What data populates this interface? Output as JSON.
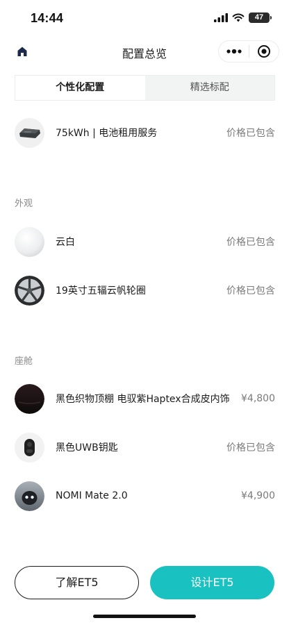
{
  "status_bar": {
    "time": "14:44",
    "battery": "47"
  },
  "nav": {
    "title": "配置总览"
  },
  "tabs": [
    {
      "label": "个性化配置",
      "active": true
    },
    {
      "label": "精选标配",
      "active": false
    }
  ],
  "battery_item": {
    "name": "75kWh | 电池租用服务",
    "price": "价格已包含"
  },
  "exterior": {
    "label": "外观",
    "items": [
      {
        "name": "云白",
        "price": "价格已包含",
        "icon": "white-paint-swatch"
      },
      {
        "name": "19英寸五辐云帆轮圈",
        "price": "价格已包含",
        "icon": "wheel-rim"
      }
    ]
  },
  "cabin": {
    "label": "座舱",
    "items": [
      {
        "name": "黑色织物顶棚 电驭紫Haptex合成皮内饰",
        "price": "¥4,800",
        "icon": "interior-swatch"
      },
      {
        "name": "黑色UWB钥匙",
        "price": "价格已包含",
        "icon": "car-key"
      },
      {
        "name": "NOMI Mate 2.0",
        "price": "¥4,900",
        "icon": "nomi-robot"
      }
    ]
  },
  "footer": {
    "learn_label": "了解ET5",
    "design_label": "设计ET5"
  },
  "colors": {
    "accent": "#19c2c0",
    "text": "#1b1b1b",
    "muted": "#8a8a8a"
  }
}
